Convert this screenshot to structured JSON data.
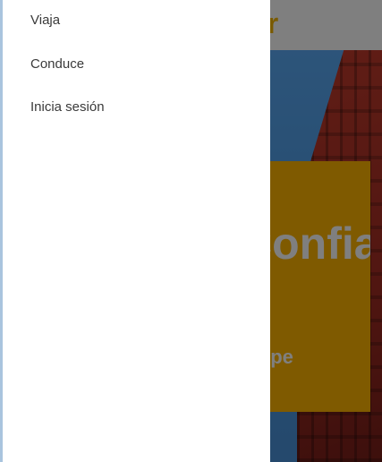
{
  "background": {
    "header_brand": "Gar",
    "card_heading": "Confianza",
    "card_link": "Empezar"
  },
  "drawer": {
    "items": [
      {
        "label": "Viaja"
      },
      {
        "label": "Conduce"
      },
      {
        "label": "Inicia sesión"
      }
    ]
  },
  "colors": {
    "brand": "#f2b400",
    "card": "#ffb400",
    "drawer_border": "#a9c4de"
  }
}
